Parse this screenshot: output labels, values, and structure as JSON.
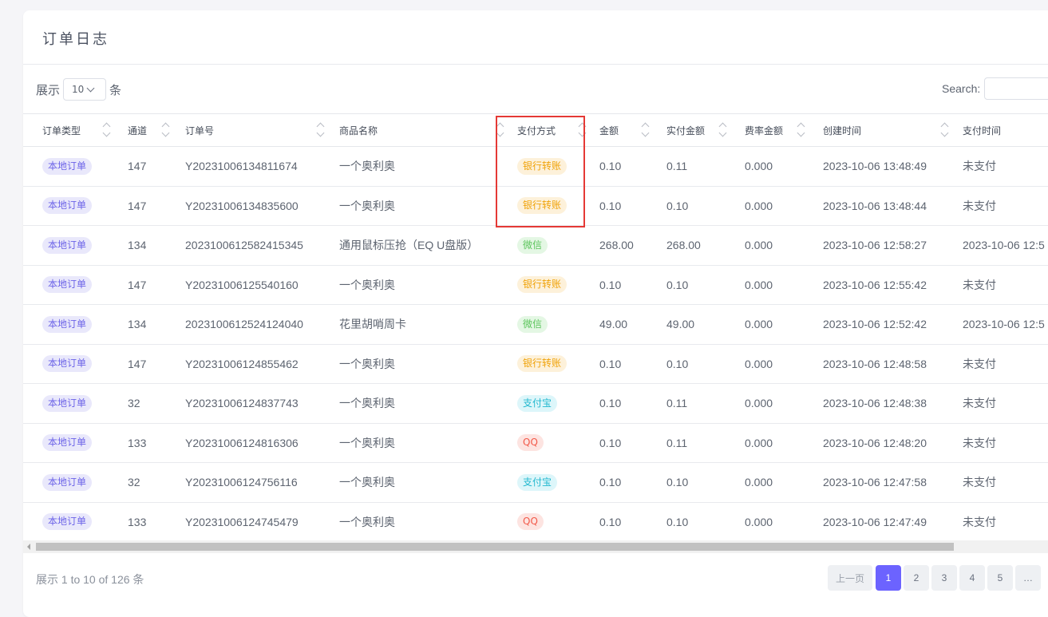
{
  "card": {
    "title": "订单日志"
  },
  "length": {
    "prefix": "展示",
    "value": "10",
    "suffix": "条"
  },
  "search": {
    "label": "Search:",
    "placeholder": ""
  },
  "table": {
    "columns": [
      "订单类型",
      "通道",
      "订单号",
      "商品名称",
      "支付方式",
      "金额",
      "实付金额",
      "费率金额",
      "创建时间",
      "支付时间"
    ],
    "rows": [
      {
        "type": "本地订单",
        "channel": "147",
        "order_no": "Y20231006134811674",
        "product": "一个奥利奥",
        "pay": "银行转账",
        "pay_kind": "bank",
        "amount": "0.10",
        "paid": "0.11",
        "fee": "0.000",
        "created": "2023-10-06 13:48:49",
        "pay_time": "未支付"
      },
      {
        "type": "本地订单",
        "channel": "147",
        "order_no": "Y20231006134835600",
        "product": "一个奥利奥",
        "pay": "银行转账",
        "pay_kind": "bank",
        "amount": "0.10",
        "paid": "0.10",
        "fee": "0.000",
        "created": "2023-10-06 13:48:44",
        "pay_time": "未支付"
      },
      {
        "type": "本地订单",
        "channel": "134",
        "order_no": "2023100612582415345",
        "product": "通用鼠标压抢（EQ U盘版）",
        "pay": "微信",
        "pay_kind": "wx",
        "amount": "268.00",
        "paid": "268.00",
        "fee": "0.000",
        "created": "2023-10-06 12:58:27",
        "pay_time": "2023-10-06 12:5"
      },
      {
        "type": "本地订单",
        "channel": "147",
        "order_no": "Y20231006125540160",
        "product": "一个奥利奥",
        "pay": "银行转账",
        "pay_kind": "bank",
        "amount": "0.10",
        "paid": "0.10",
        "fee": "0.000",
        "created": "2023-10-06 12:55:42",
        "pay_time": "未支付"
      },
      {
        "type": "本地订单",
        "channel": "134",
        "order_no": "2023100612524124040",
        "product": "花里胡哨周卡",
        "pay": "微信",
        "pay_kind": "wx",
        "amount": "49.00",
        "paid": "49.00",
        "fee": "0.000",
        "created": "2023-10-06 12:52:42",
        "pay_time": "2023-10-06 12:5"
      },
      {
        "type": "本地订单",
        "channel": "147",
        "order_no": "Y20231006124855462",
        "product": "一个奥利奥",
        "pay": "银行转账",
        "pay_kind": "bank",
        "amount": "0.10",
        "paid": "0.10",
        "fee": "0.000",
        "created": "2023-10-06 12:48:58",
        "pay_time": "未支付"
      },
      {
        "type": "本地订单",
        "channel": "32",
        "order_no": "Y20231006124837743",
        "product": "一个奥利奥",
        "pay": "支付宝",
        "pay_kind": "ali",
        "amount": "0.10",
        "paid": "0.11",
        "fee": "0.000",
        "created": "2023-10-06 12:48:38",
        "pay_time": "未支付"
      },
      {
        "type": "本地订单",
        "channel": "133",
        "order_no": "Y20231006124816306",
        "product": "一个奥利奥",
        "pay": "QQ",
        "pay_kind": "qq",
        "amount": "0.10",
        "paid": "0.11",
        "fee": "0.000",
        "created": "2023-10-06 12:48:20",
        "pay_time": "未支付"
      },
      {
        "type": "本地订单",
        "channel": "32",
        "order_no": "Y20231006124756116",
        "product": "一个奥利奥",
        "pay": "支付宝",
        "pay_kind": "ali",
        "amount": "0.10",
        "paid": "0.10",
        "fee": "0.000",
        "created": "2023-10-06 12:47:58",
        "pay_time": "未支付"
      },
      {
        "type": "本地订单",
        "channel": "133",
        "order_no": "Y20231006124745479",
        "product": "一个奥利奥",
        "pay": "QQ",
        "pay_kind": "qq",
        "amount": "0.10",
        "paid": "0.10",
        "fee": "0.000",
        "created": "2023-10-06 12:47:49",
        "pay_time": "未支付"
      }
    ]
  },
  "footer": {
    "info": "展示 1 to 10 of 126 条",
    "prev": "上一页",
    "pages": [
      "1",
      "2",
      "3",
      "4",
      "5",
      "…"
    ],
    "active_page": "1"
  }
}
